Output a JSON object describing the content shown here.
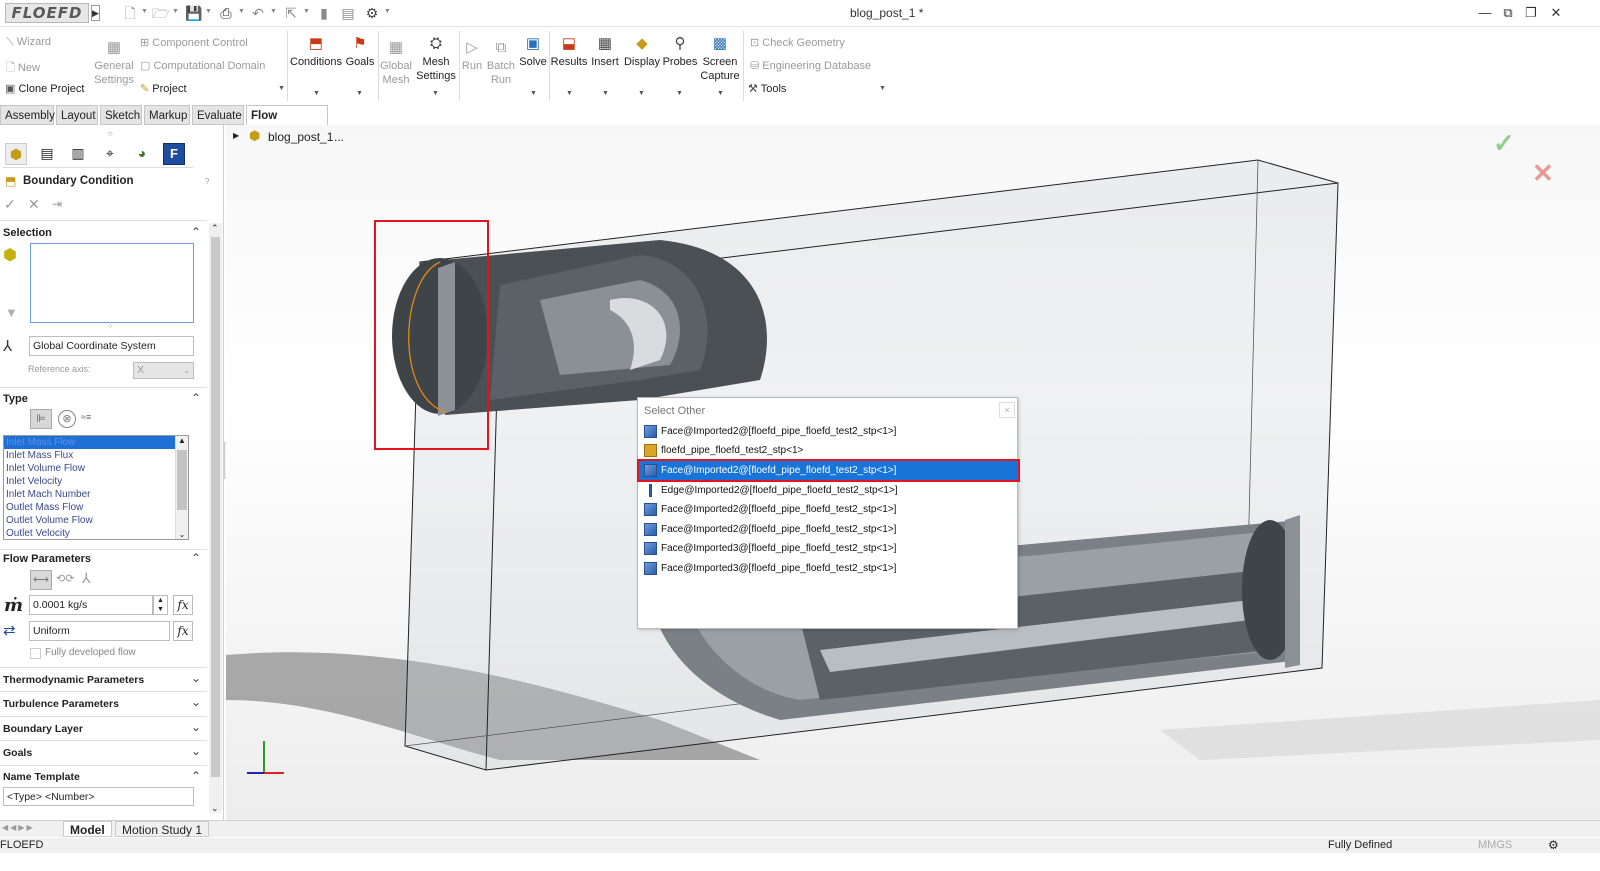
{
  "app": {
    "logo": "FLOEFD",
    "doc_title": "blog_post_1 *"
  },
  "ribbon": {
    "wizard": "Wizard",
    "new": "New",
    "clone_project": "Clone Project",
    "general_settings_1": "General",
    "general_settings_2": "Settings",
    "component_control": "Component Control",
    "computational_domain": "Computational Domain",
    "project": "Project",
    "conditions": "Conditions",
    "goals": "Goals",
    "global_mesh_1": "Global",
    "global_mesh_2": "Mesh",
    "mesh_settings_1": "Mesh",
    "mesh_settings_2": "Settings",
    "run": "Run",
    "batch_run_1": "Batch",
    "batch_run_2": "Run",
    "solve": "Solve",
    "results": "Results",
    "insert": "Insert",
    "display": "Display",
    "probes": "Probes",
    "screen_capture_1": "Screen",
    "screen_capture_2": "Capture",
    "check_geometry": "Check Geometry",
    "engineering_database": "Engineering Database",
    "tools": "Tools"
  },
  "tabs": [
    "Assembly",
    "Layout",
    "Sketch",
    "Markup",
    "Evaluate",
    "Flow Analysis"
  ],
  "tree": {
    "root": "blog_post_1",
    "ellipsis": "..."
  },
  "panel": {
    "title": "Boundary Condition",
    "help": "?",
    "selection": "Selection",
    "coord_system": "Global Coordinate System",
    "reference_axis_label": "Reference axis:",
    "reference_axis_value": "X",
    "type": "Type",
    "type_list": [
      "Inlet Mass Flow",
      "Inlet Mass Flux",
      "Inlet Volume Flow",
      "Inlet Velocity",
      "Inlet Mach Number",
      "Outlet Mass Flow",
      "Outlet Volume Flow",
      "Outlet Velocity"
    ],
    "flow_parameters": "Flow Parameters",
    "mass_flow_value": "0.0001 kg/s",
    "profile_value": "Uniform",
    "fully_developed": "Fully developed flow",
    "thermodynamic": "Thermodynamic Parameters",
    "turbulence": "Turbulence Parameters",
    "boundary_layer": "Boundary Layer",
    "goals": "Goals",
    "name_template": "Name Template",
    "name_template_value": "<Type> <Number>",
    "fx": "fx",
    "mdot": "ṁ"
  },
  "popup": {
    "title": "Select Other",
    "close": "×",
    "items": [
      "Face@Imported2@[floefd_pipe_floefd_test2_stp<1>]",
      "floefd_pipe_floefd_test2_stp<1>",
      "Face@Imported2@[floefd_pipe_floefd_test2_stp<1>]",
      "Edge@Imported2@[floefd_pipe_floefd_test2_stp<1>]",
      "Face@Imported2@[floefd_pipe_floefd_test2_stp<1>]",
      "Face@Imported2@[floefd_pipe_floefd_test2_stp<1>]",
      "Face@Imported3@[floefd_pipe_floefd_test2_stp<1>]",
      "Face@Imported3@[floefd_pipe_floefd_test2_stp<1>]"
    ]
  },
  "bottom_tabs": [
    "Model",
    "Motion Study 1"
  ],
  "status": {
    "left": "FLOEFD",
    "defined": "Fully Defined",
    "units": "MMGS"
  },
  "colors": {
    "selection_blue": "#1874d6",
    "highlight_red": "#e3141e",
    "accent_green": "#3aa24a"
  }
}
